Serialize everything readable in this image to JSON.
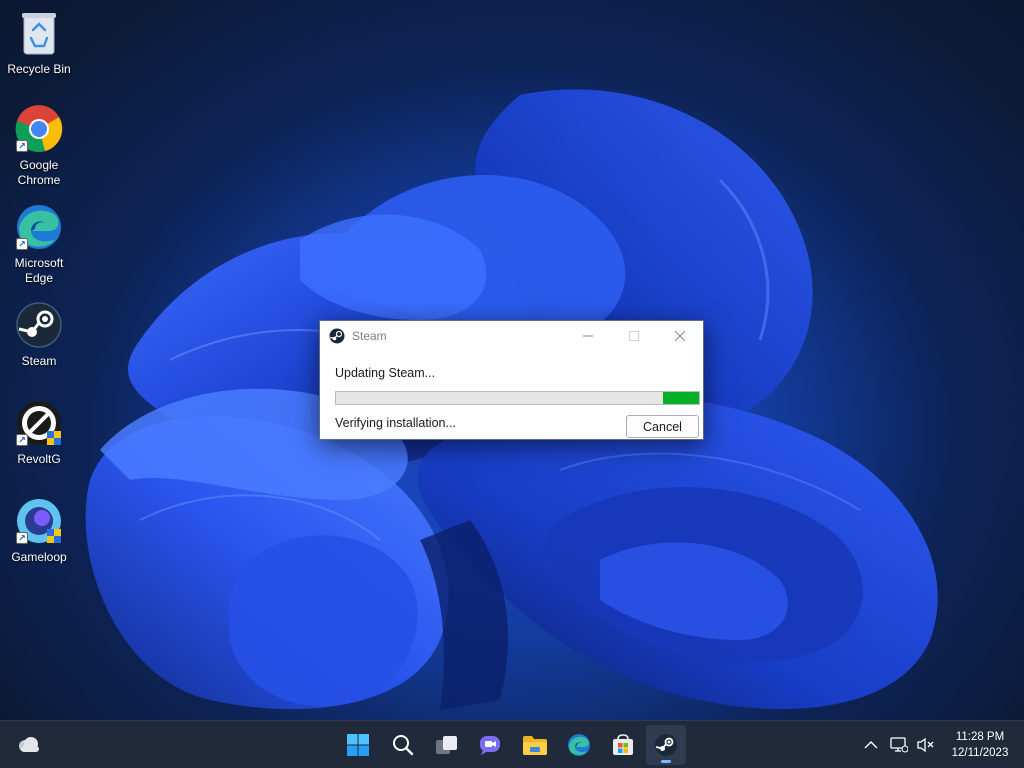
{
  "desktop": {
    "icons": [
      {
        "label": "Recycle Bin"
      },
      {
        "label": "Google\nChrome"
      },
      {
        "label": "Microsoft\nEdge"
      },
      {
        "label": "Steam"
      },
      {
        "label": "RevoltG"
      },
      {
        "label": "Gameloop"
      }
    ]
  },
  "dialog": {
    "title": "Steam",
    "message": "Updating Steam...",
    "progress_percent": 90,
    "status": "Verifying installation...",
    "cancel_label": "Cancel"
  },
  "taskbar": {
    "apps": [
      "start",
      "search",
      "task-view",
      "teams-chat",
      "file-explorer",
      "edge",
      "microsoft-store",
      "steam"
    ],
    "active_app": "steam",
    "clock": {
      "time": "11:28 PM",
      "date": "12/11/2023"
    }
  },
  "colors": {
    "progress_fill": "#06b025",
    "taskbar_bg": "#202a3a",
    "wallpaper_accent": "#1f4fd8"
  }
}
